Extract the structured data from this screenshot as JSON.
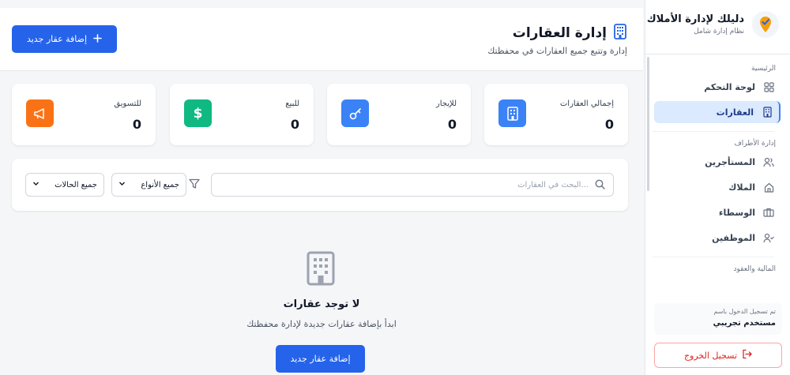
{
  "brand": {
    "title": "دليلك لإدارة الأملاك",
    "subtitle": "نظام إدارة شامل"
  },
  "sidebar": {
    "section_main": "الرئيسية",
    "items_main": [
      {
        "label": "لوحة التحكم",
        "icon": "grid-icon",
        "active": false
      },
      {
        "label": "العقارات",
        "icon": "building-icon",
        "active": true
      }
    ],
    "section_parties": "إدارة الأطراف",
    "items_parties": [
      {
        "label": "المستأجرين",
        "icon": "users-icon"
      },
      {
        "label": "الملاك",
        "icon": "home-icon"
      },
      {
        "label": "الوسطاء",
        "icon": "briefcase-icon"
      },
      {
        "label": "الموظفين",
        "icon": "user-check-icon"
      }
    ],
    "section_finance": "المالية والعقود",
    "user_label": "تم تسجيل الدخول باسم",
    "user_name": "مستخدم تجريبي",
    "logout_label": "تسجيل الخروج"
  },
  "header": {
    "title": "إدارة العقارات",
    "subtitle": "إدارة وتتبع جميع العقارات في محفظتك",
    "add_button": "إضافة عقار جديد"
  },
  "stats": [
    {
      "label": "إجمالي العقارات",
      "value": "0",
      "color": "#3b82f6",
      "icon": "building-icon"
    },
    {
      "label": "للإيجار",
      "value": "0",
      "color": "#3b82f6",
      "icon": "key-icon"
    },
    {
      "label": "للبيع",
      "value": "0",
      "color": "#10b981",
      "icon": "dollar-icon"
    },
    {
      "label": "للتسويق",
      "value": "0",
      "color": "#f97316",
      "icon": "megaphone-icon"
    }
  ],
  "filters": {
    "search_placeholder": "البحث في العقارات...",
    "type_select": "جميع الأنواع",
    "status_select": "جميع الحالات"
  },
  "empty": {
    "title": "لا توجد عقارات",
    "subtitle": "ابدأ بإضافة عقارات جديدة لإدارة محفظتك",
    "add_button": "إضافة عقار جديد"
  },
  "colors": {
    "primary": "#2563eb",
    "active_bg": "#dbeafe",
    "danger": "#dc2626"
  }
}
